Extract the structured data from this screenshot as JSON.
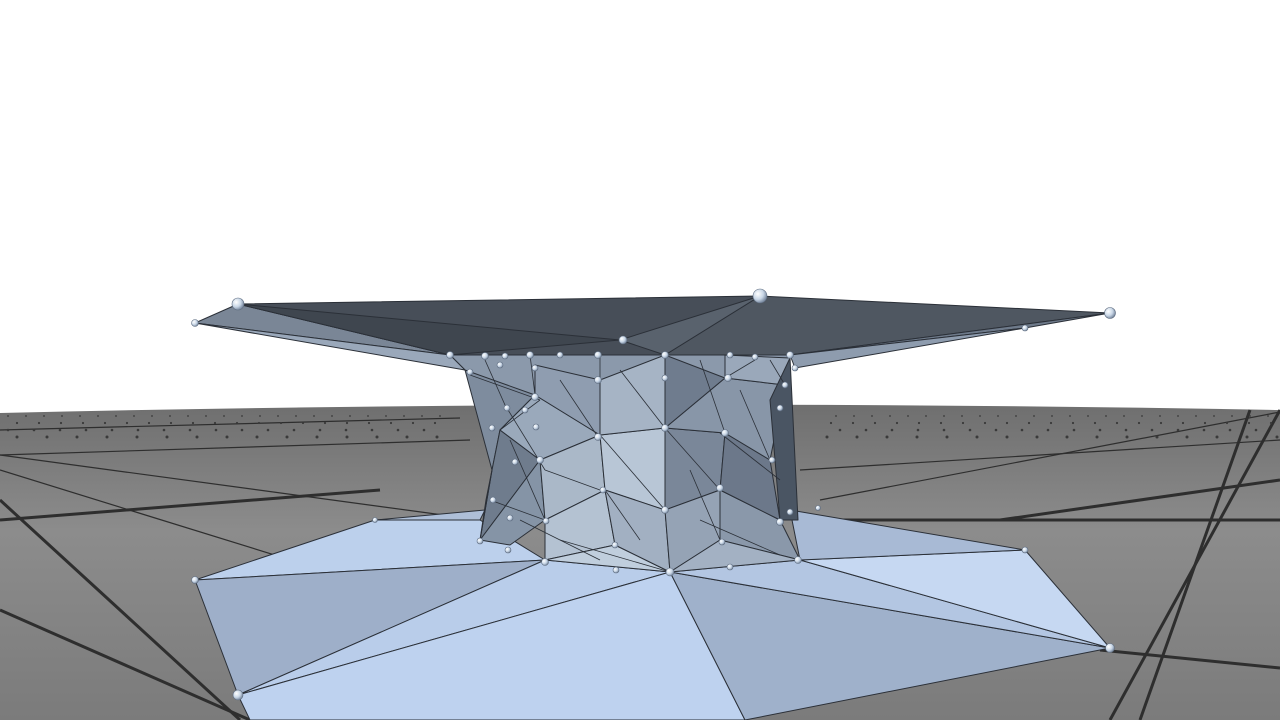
{
  "scene": {
    "kind": "3d-mesh-viewport",
    "background_color": "#ffffff",
    "floor": {
      "tile_color": "#8a8a8a",
      "grid_line_color": "#2e2e2e",
      "dot_color": "#3a3a3a"
    },
    "mesh": {
      "top_face_color": "#464d56",
      "body_light": "#aab8c8",
      "body_mid": "#8796a8",
      "body_dark": "#6f7c8d",
      "base_light": "#c3d4ee",
      "base_mid": "#a9bad4",
      "edge_color": "#2b3038",
      "vertex_color": "#dfe8f2"
    }
  }
}
